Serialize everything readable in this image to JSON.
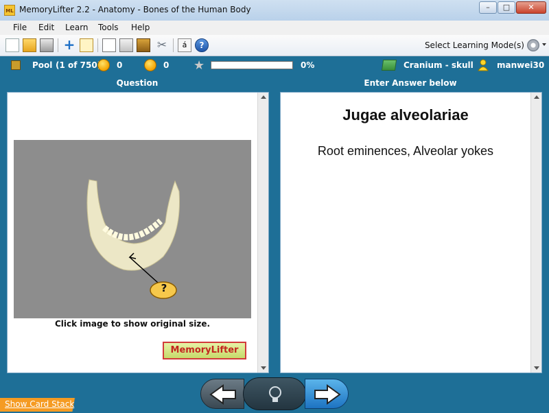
{
  "window": {
    "app_icon_text": "ML",
    "title": "MemoryLifter 2.2 - Anatomy - Bones of the Human Body"
  },
  "menu": [
    "File",
    "Edit",
    "Learn",
    "Tools",
    "Help"
  ],
  "toolbar": {
    "mode_label": "Select Learning Mode(s)"
  },
  "status": {
    "pool_label": "Pool",
    "pool_count": "(1 of 750)",
    "happy_count": "0",
    "sad_count": "0",
    "progress_text": "0%",
    "progress_value": 0,
    "module_name": "Cranium - skull",
    "user": "manwei30"
  },
  "question_panel": {
    "header": "Question",
    "caption": "Click image to show original size.",
    "callout": "?",
    "logo_text": "MemoryLifter"
  },
  "answer_panel": {
    "header": "Enter Answer below",
    "question_term": "Jugae alveolariae",
    "answer": "Root eminences, Alveolar yokes"
  },
  "footer": {
    "card_stack_link": "Show Card Stack"
  },
  "colors": {
    "chrome": "#1e6f97",
    "accent": "#f59b22"
  }
}
